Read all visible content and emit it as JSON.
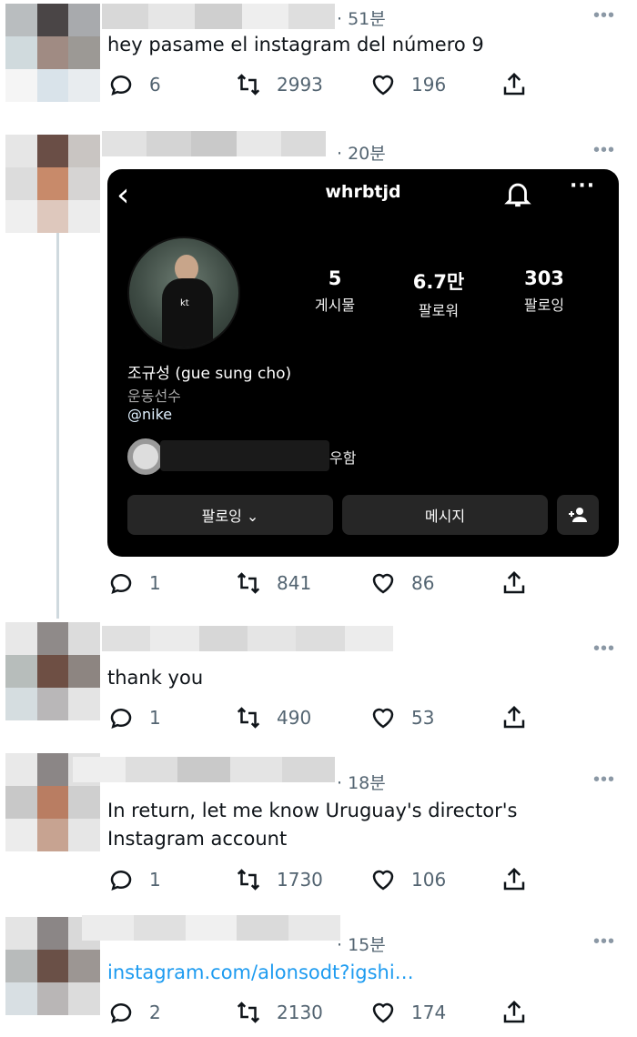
{
  "tweets": [
    {
      "time": "· 51분",
      "text": "hey pasame el instagram del número 9",
      "replies": "6",
      "retweets": "2993",
      "likes": "196"
    },
    {
      "time": "· 20분",
      "replies": "1",
      "retweets": "841",
      "likes": "86",
      "instagram_card": {
        "username": "whrbtjd",
        "posts": "5",
        "posts_label": "게시물",
        "followers": "6.7만",
        "followers_label": "팔로워",
        "following": "303",
        "following_label": "팔로잉",
        "name": "조규성 (gue sung cho)",
        "category": "운동선수",
        "link": "@nike",
        "followed_by_suffix": "우함",
        "photo_badge": "kt",
        "follow_button": "팔로잉 ⌄",
        "message_button": "메시지"
      }
    },
    {
      "text": "thank you",
      "replies": "1",
      "retweets": "490",
      "likes": "53"
    },
    {
      "time": "· 18분",
      "text_line1": "In return, let me know Uruguay's director's",
      "text_line2": "Instagram account",
      "replies": "1",
      "retweets": "1730",
      "likes": "106"
    },
    {
      "time": "· 15분",
      "link": "instagram.com/alonsodt?igshi…",
      "replies": "2",
      "retweets": "2130",
      "likes": "174"
    }
  ],
  "more_label": "•••",
  "icons": [
    "reply-icon",
    "retweet-icon",
    "like-icon",
    "share-icon",
    "back-icon",
    "bell-icon",
    "add-person-icon"
  ],
  "colors": {
    "link": "#1d9bf0",
    "secondary_text": "#536471",
    "card_bg": "#000000",
    "button_bg": "#262626"
  }
}
